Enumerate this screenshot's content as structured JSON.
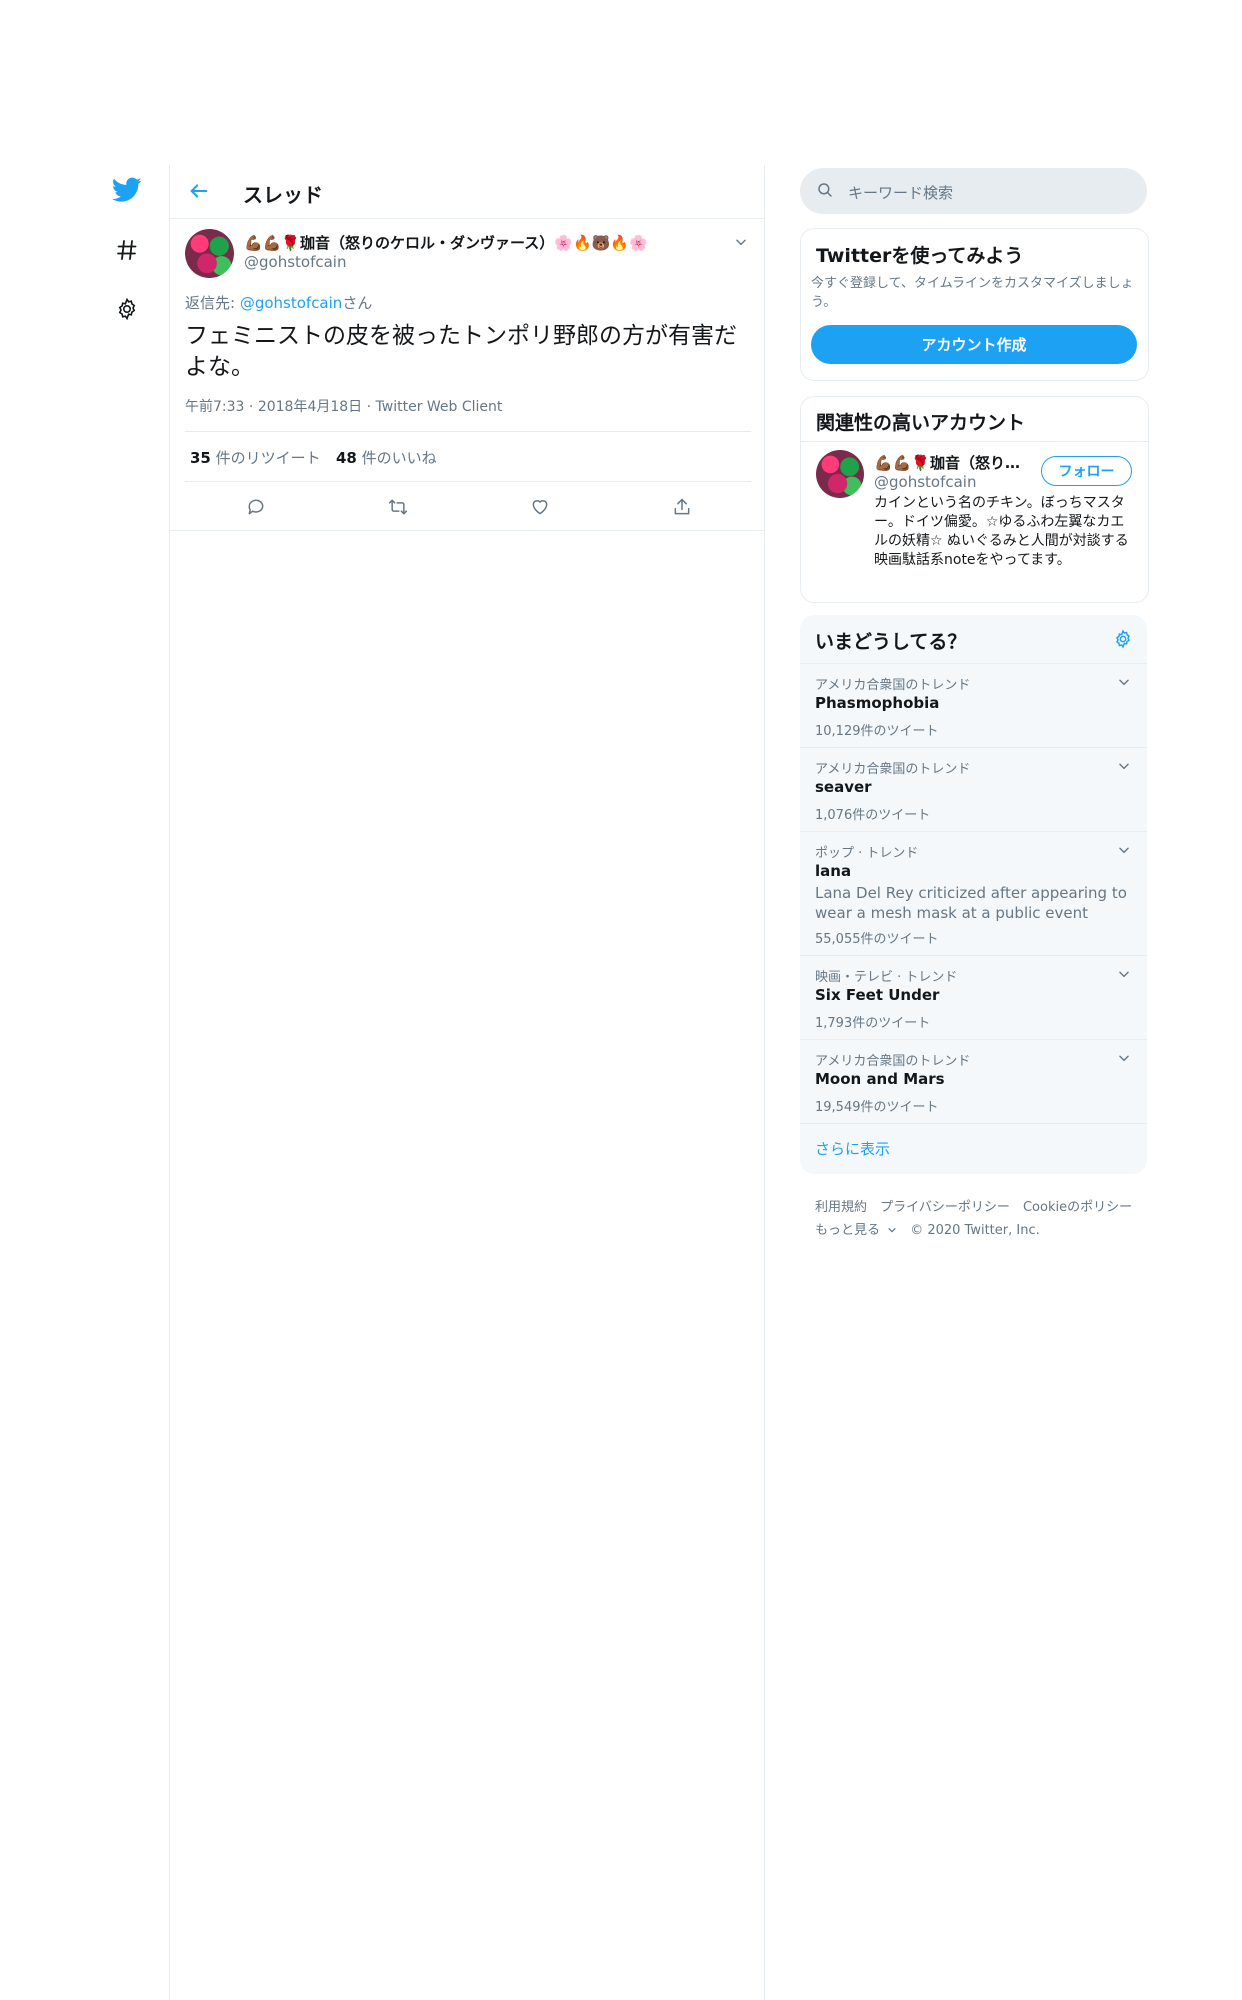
{
  "nav": {
    "logo": "twitter-bird",
    "explore": "hashtag",
    "settings": "gear"
  },
  "header": {
    "title": "スレッド"
  },
  "tweet": {
    "display_name": "💪🏾💪🏾🌹珈音（怒りのケロル・ダンヴァース）🌸🔥🐻🔥🌸",
    "handle": "@gohstofcain",
    "reply_prefix": "返信先: ",
    "reply_to": "@gohstofcain",
    "reply_suffix": "さん",
    "text": "フェミニストの皮を被ったトンポリ野郎の方が有害だよな。",
    "time": "午前7:33",
    "date": "2018年4月18日",
    "client": "Twitter Web Client",
    "retweet_count": "35",
    "retweet_label": " 件のリツイート",
    "like_count": "48",
    "like_label": " 件のいいね"
  },
  "search": {
    "placeholder": "キーワード検索"
  },
  "signup_card": {
    "title": "Twitterを使ってみよう",
    "subtitle": "今すぐ登録して、タイムラインをカスタマイズしましょう。",
    "button": "アカウント作成"
  },
  "related_card": {
    "title": "関連性の高いアカウント",
    "name": "💪🏾💪🏾🌹珈音（怒り…",
    "handle": "@gohstofcain",
    "follow": "フォロー",
    "bio": "カインという名のチキン。ぼっちマスター。ドイツ偏愛。☆ゆるふわ左翼なカエルの妖精☆ ぬいぐるみと人間が対談する映画駄話系noteをやってます。"
  },
  "trends": {
    "title": "いまどうしてる？",
    "items": [
      {
        "context": "アメリカ合衆国のトレンド",
        "name": "Phasmophobia",
        "desc": "",
        "count": "10,129件のツイート"
      },
      {
        "context": "アメリカ合衆国のトレンド",
        "name": "seaver",
        "desc": "",
        "count": "1,076件のツイート"
      },
      {
        "context": "ポップ · トレンド",
        "name": "lana",
        "desc": "Lana Del Rey criticized after appearing to wear a mesh mask at a public event",
        "count": "55,055件のツイート"
      },
      {
        "context": "映画・テレビ · トレンド",
        "name": "Six Feet Under",
        "desc": "",
        "count": "1,793件のツイート"
      },
      {
        "context": "アメリカ合衆国のトレンド",
        "name": "Moon and Mars",
        "desc": "",
        "count": "19,549件のツイート"
      }
    ],
    "show_more": "さらに表示"
  },
  "footer": {
    "terms": "利用規約",
    "privacy": "プライバシーポリシー",
    "cookie": "Cookieのポリシー",
    "more": "もっと見る",
    "copyright": "© 2020 Twitter, Inc."
  },
  "colors": {
    "accent": "#1da1f2",
    "border": "#e6ecf0",
    "muted": "#657786"
  }
}
